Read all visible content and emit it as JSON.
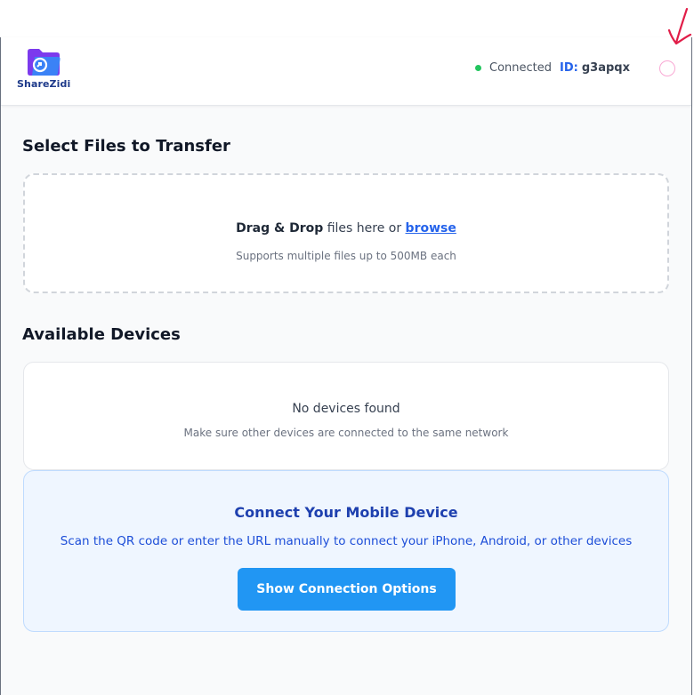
{
  "app": {
    "brand": "ShareZidi"
  },
  "status": {
    "text": "Connected",
    "id_label": "ID:",
    "id_value": "g3apqx"
  },
  "upload": {
    "title": "Select Files to Transfer",
    "drag_bold": "Drag & Drop",
    "drag_rest": " files here or ",
    "browse": "browse",
    "hint": "Supports multiple files up to 500MB each"
  },
  "devices": {
    "title": "Available Devices",
    "empty_title": "No devices found",
    "empty_hint": "Make sure other devices are connected to the same network"
  },
  "mobile": {
    "title": "Connect Your Mobile Device",
    "description": "Scan the QR code or enter the URL manually to connect your iPhone, Android, or other devices",
    "button": "Show Connection Options"
  },
  "colors": {
    "accent": "#2196f3",
    "brand": "#1e3a8a",
    "online": "#22c55e",
    "annotation": "#e11d48"
  }
}
